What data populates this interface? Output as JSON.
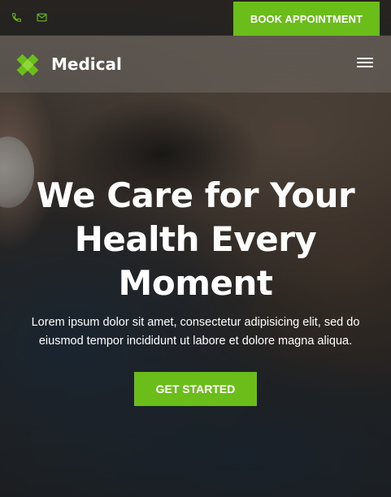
{
  "topbar": {
    "phone_icon": "phone-icon",
    "mail_icon": "envelope-icon",
    "book_label": "BOOK APPOINTMENT"
  },
  "header": {
    "logo_icon": "medical-cross-logo-icon",
    "brand": "Medical",
    "menu_icon": "hamburger-menu-icon"
  },
  "hero": {
    "title": "We Care for Your Health Every Moment",
    "text": "Lorem ipsum dolor sit amet, consectetur adipisicing elit, sed do eiusmod tempor incididunt ut labore et dolore magna aliqua.",
    "cta_label": "GET STARTED"
  },
  "colors": {
    "accent": "#6bbd1a",
    "topbar": "#232120",
    "text": "#ffffff"
  }
}
